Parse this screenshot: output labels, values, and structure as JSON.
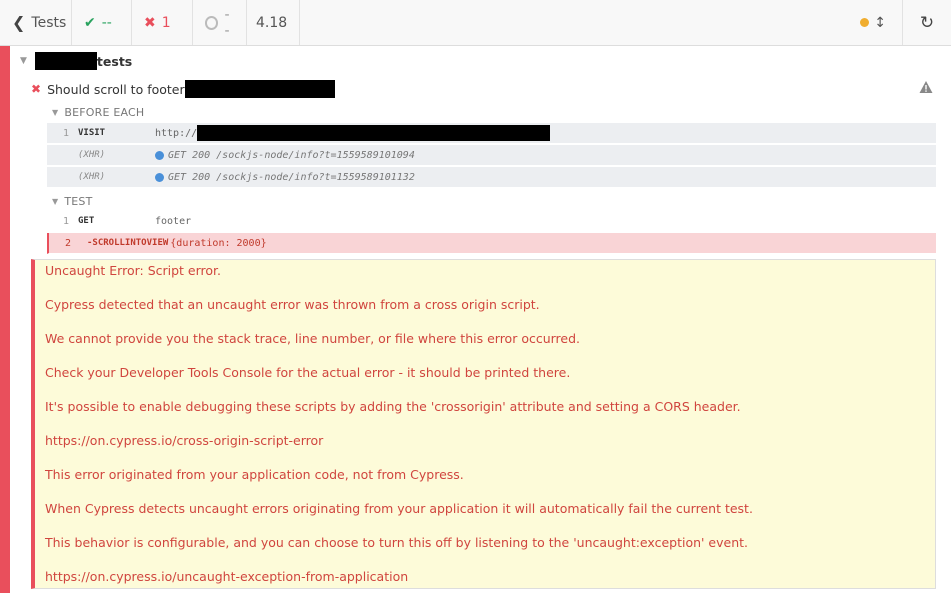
{
  "toolbar": {
    "back_label": "Tests",
    "passed": "--",
    "failed": "1",
    "pending": "--",
    "duration": "4.18"
  },
  "suite": {
    "title": "tests"
  },
  "test": {
    "title": "Should scroll to footer"
  },
  "before_each": {
    "label": "BEFORE EACH",
    "commands": [
      {
        "num": "1",
        "name": "VISIT",
        "message": "http://"
      },
      {
        "num": "",
        "name": "(XHR)",
        "message": "GET 200 /sockjs-node/info?t=1559589101094"
      },
      {
        "num": "",
        "name": "(XHR)",
        "message": "GET 200 /sockjs-node/info?t=1559589101132"
      }
    ]
  },
  "test_body": {
    "label": "TEST",
    "commands": [
      {
        "num": "1",
        "name": "GET",
        "message": "footer"
      },
      {
        "num": "2",
        "name": "-SCROLLINTOVIEW",
        "message": "{duration: 2000}"
      }
    ]
  },
  "error": {
    "lines": [
      "Uncaught Error: Script error.",
      "Cypress detected that an uncaught error was thrown from a cross origin script.",
      "We cannot provide you the stack trace, line number, or file where this error occurred.",
      "Check your Developer Tools Console for the actual error - it should be printed there.",
      "It's possible to enable debugging these scripts by adding the 'crossorigin' attribute and setting a CORS header.",
      "https://on.cypress.io/cross-origin-script-error",
      "This error originated from your application code, not from Cypress.",
      "When Cypress detects uncaught errors originating from your application it will automatically fail the current test.",
      "This behavior is configurable, and you can choose to turn this off by listening to the 'uncaught:exception' event.",
      "https://on.cypress.io/uncaught-exception-from-application"
    ]
  },
  "colors": {
    "fail": "#e94f5c",
    "pass": "#2aa35f",
    "pending_dot": "#f0ad2f",
    "xhr_dot": "#4a90d9",
    "error_bg": "#fdfbd9"
  },
  "icons": {
    "back": "chevron-left-icon",
    "passed": "check-icon",
    "failed": "x-icon",
    "pending": "circle-outline-icon",
    "running": "orange-dot-icon",
    "scroll": "up-down-arrow-icon",
    "reload": "reload-icon",
    "warning": "warning-triangle-icon"
  }
}
